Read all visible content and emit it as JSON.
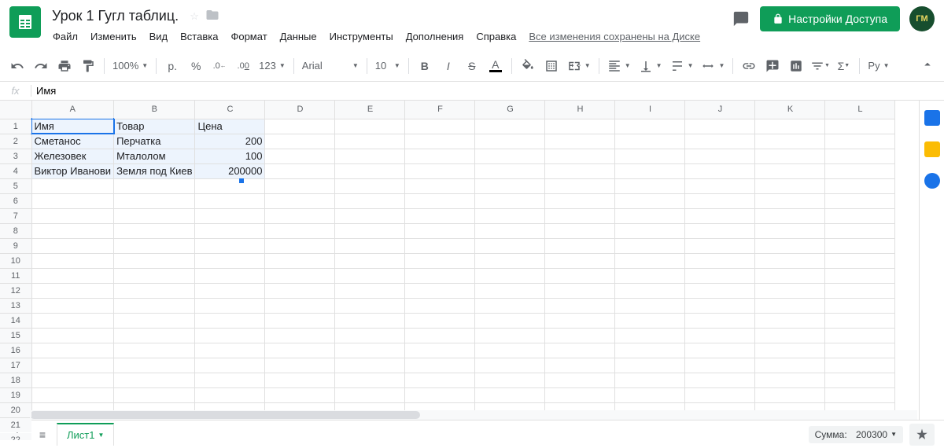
{
  "doc": {
    "title": "Урок 1 Гугл таблиц."
  },
  "menu": {
    "file": "Файл",
    "edit": "Изменить",
    "view": "Вид",
    "insert": "Вставка",
    "format": "Формат",
    "data": "Данные",
    "tools": "Инструменты",
    "addons": "Дополнения",
    "help": "Справка",
    "save_status": "Все изменения сохранены на Диске"
  },
  "share": {
    "label": "Настройки Доступа"
  },
  "avatar": {
    "initials": "ГМ"
  },
  "toolbar": {
    "zoom": "100%",
    "currency": "р.",
    "percent": "%",
    "dec_dec": ".0",
    "dec_inc": ".00",
    "more_fmt": "123",
    "font": "Arial",
    "size": "10",
    "typing": "Ру"
  },
  "fx": {
    "label": "fx",
    "value": "Имя"
  },
  "columns": [
    "A",
    "B",
    "C",
    "D",
    "E",
    "F",
    "G",
    "H",
    "I",
    "J",
    "K",
    "L"
  ],
  "cells": {
    "A1": "Имя",
    "B1": "Товар",
    "C1": "Цена",
    "A2": "Сметанос",
    "B2": "Перчатка",
    "C2": "200",
    "A3": "Железовек",
    "B3": "Мталолом",
    "C3": "100",
    "A4": "Виктор Иванови",
    "B4": "Земля под Киев",
    "C4": "200000"
  },
  "rows_visible": 22,
  "sheet_tab": {
    "name": "Лист1"
  },
  "footer": {
    "sum_label": "Сумма:",
    "sum_value": "200300"
  }
}
